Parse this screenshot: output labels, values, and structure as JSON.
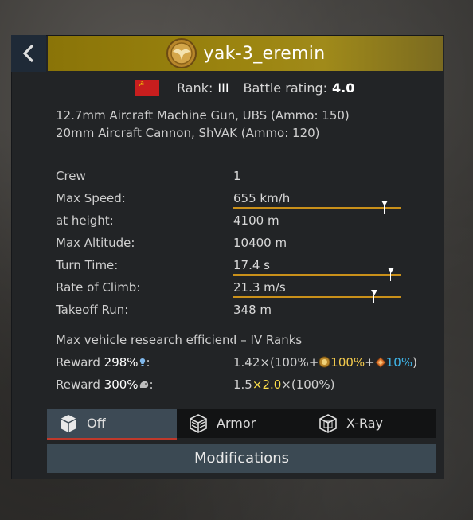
{
  "vehicle": {
    "name": "yak-3_eremin",
    "rank_label": "Rank:",
    "rank_value": "III",
    "br_label": "Battle rating:",
    "br_value": "4.0",
    "nation_flag": "ussr-flag"
  },
  "weapons": [
    "12.7mm Aircraft Machine Gun, UBS (Ammo: 150)",
    "20mm Aircraft Cannon, ShVAK (Ammo: 120)"
  ],
  "stats": [
    {
      "label": "Crew",
      "value": "1"
    },
    {
      "label": "Max Speed:",
      "value": "655 km/h",
      "bar_marker": 0.88
    },
    {
      "label": "at height:",
      "value": "4100 m"
    },
    {
      "label": "Max Altitude:",
      "value": "10400 m"
    },
    {
      "label": "Turn Time:",
      "value": "17.4 s",
      "bar_marker": 0.92
    },
    {
      "label": "Rate of Climb:",
      "value": "21.3 m/s",
      "bar_marker": 0.82
    },
    {
      "label": "Takeoff Run:",
      "value": "348 m"
    }
  ],
  "research": {
    "label": "Max vehicle research efficiency",
    "value": "I – IV Ranks"
  },
  "rewards": {
    "rp_label": "Reward",
    "rp_pct": "298%",
    "rp_icon": "research-bulb-icon",
    "rp_mult": "1.42",
    "rp_open": "×(100%+",
    "rp_gold_pct": "100%",
    "rp_plus": "+",
    "rp_cyan_pct": "10%",
    "rp_close": ")",
    "sl_label": "Reward",
    "sl_pct": "300%",
    "sl_icon": "silver-lions-icon",
    "sl_mult": "1.5",
    "sl_x": "×",
    "sl_bonus": "2.0",
    "sl_rest": "×(100%)",
    "colon": ":"
  },
  "tabs": [
    {
      "label": "Off",
      "icon": "cube-icon",
      "active": true
    },
    {
      "label": "Armor",
      "icon": "armor-cube-icon",
      "active": false
    },
    {
      "label": "X-Ray",
      "icon": "xray-cube-icon",
      "active": false
    }
  ],
  "modifications_label": "Modifications",
  "colors": {
    "title_gold": "#9c8510",
    "bar_orange": "#c9901a",
    "tab_active": "#3d4a55",
    "tab_underline": "#c0392b",
    "gold_text": "#f2c94c",
    "cyan_text": "#3fb6ea",
    "yellow_text": "#ffe14a"
  }
}
